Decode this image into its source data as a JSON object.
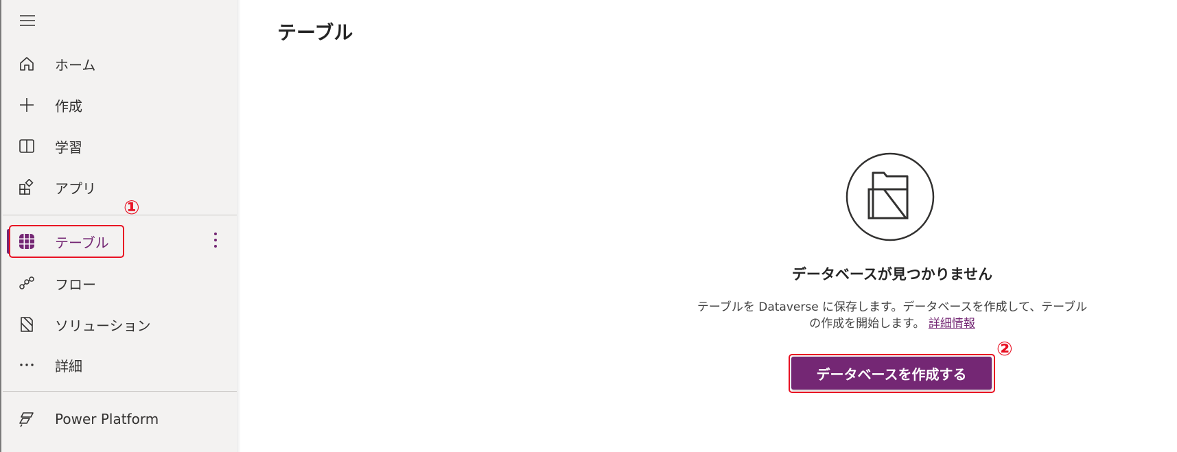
{
  "sidebar": {
    "menu_icon": "hamburger-icon",
    "items": [
      {
        "label": "ホーム",
        "icon": "home-icon"
      },
      {
        "label": "作成",
        "icon": "plus-icon"
      },
      {
        "label": "学習",
        "icon": "book-icon"
      },
      {
        "label": "アプリ",
        "icon": "apps-icon"
      },
      {
        "label": "テーブル",
        "icon": "table-grid-icon",
        "selected": true
      },
      {
        "label": "フロー",
        "icon": "flow-icon"
      },
      {
        "label": "ソリューション",
        "icon": "solution-icon"
      },
      {
        "label": "詳細",
        "icon": "more-horizontal-icon"
      },
      {
        "label": "Power Platform",
        "icon": "power-platform-icon"
      }
    ]
  },
  "annotations": {
    "step1": "①",
    "step2": "②",
    "color": "#e81123"
  },
  "main": {
    "title": "テーブル",
    "empty_state": {
      "icon": "folder-stack-icon",
      "title": "データベースが見つかりません",
      "description_line1": "テーブルを Dataverse に保存します。データベースを作成して、テーブル",
      "description_line2": "の作成を開始します。",
      "learn_more": "詳細情報",
      "button_label": "データベースを作成する"
    }
  },
  "colors": {
    "accent": "#742774",
    "sidebar_bg": "#f3f2f1"
  }
}
